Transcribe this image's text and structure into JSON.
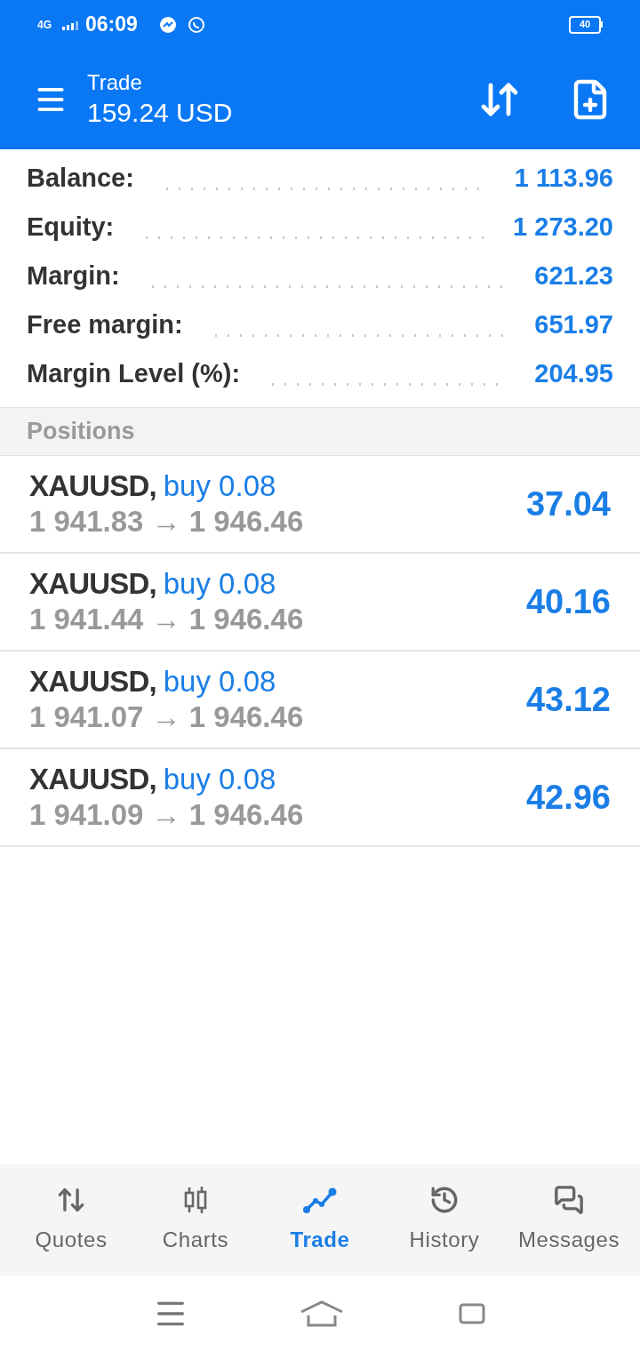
{
  "status_bar": {
    "network": "4G",
    "time": "06:09",
    "battery": "40"
  },
  "header": {
    "title": "Trade",
    "subtitle": "159.24 USD"
  },
  "summary": [
    {
      "label": "Balance:",
      "value": "1 113.96"
    },
    {
      "label": "Equity:",
      "value": "1 273.20"
    },
    {
      "label": "Margin:",
      "value": "621.23"
    },
    {
      "label": "Free margin:",
      "value": "651.97"
    },
    {
      "label": "Margin Level (%):",
      "value": "204.95"
    }
  ],
  "positions_header": "Positions",
  "positions": [
    {
      "symbol": "XAUUSD,",
      "side": "buy 0.08",
      "prices": "1 941.83 → 1 946.46",
      "profit": "37.04"
    },
    {
      "symbol": "XAUUSD,",
      "side": "buy 0.08",
      "prices": "1 941.44 → 1 946.46",
      "profit": "40.16"
    },
    {
      "symbol": "XAUUSD,",
      "side": "buy 0.08",
      "prices": "1 941.07 → 1 946.46",
      "profit": "43.12"
    },
    {
      "symbol": "XAUUSD,",
      "side": "buy 0.08",
      "prices": "1 941.09 → 1 946.46",
      "profit": "42.96"
    }
  ],
  "tabs": [
    {
      "label": "Quotes",
      "kind": "quotes",
      "selected": false
    },
    {
      "label": "Charts",
      "kind": "charts",
      "selected": false
    },
    {
      "label": "Trade",
      "kind": "trade",
      "selected": true
    },
    {
      "label": "History",
      "kind": "history",
      "selected": false
    },
    {
      "label": "Messages",
      "kind": "messages",
      "selected": false
    }
  ]
}
